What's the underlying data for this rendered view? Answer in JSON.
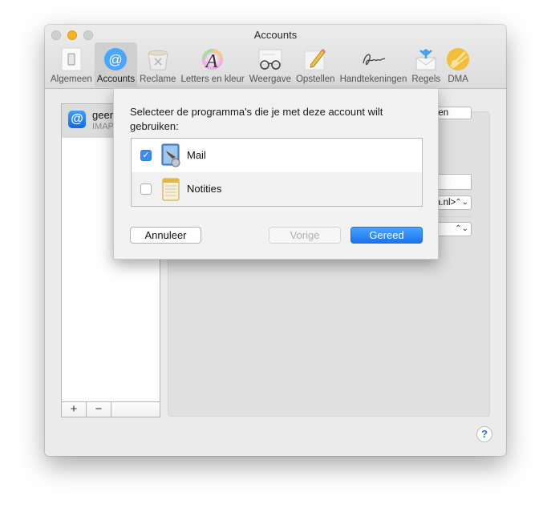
{
  "window": {
    "title": "Accounts",
    "traffic_lights": [
      "close",
      "minimize",
      "zoom"
    ]
  },
  "toolbar": {
    "items": [
      {
        "label": "Algemeen",
        "icon": "switch-icon",
        "active": false
      },
      {
        "label": "Accounts",
        "icon": "at-sign-icon",
        "active": true
      },
      {
        "label": "Reclame",
        "icon": "junk-bin-icon",
        "active": false
      },
      {
        "label": "Letters en kleur",
        "icon": "font-color-icon",
        "active": false
      },
      {
        "label": "Weergave",
        "icon": "glasses-icon",
        "active": false
      },
      {
        "label": "Opstellen",
        "icon": "pencil-icon",
        "active": false
      },
      {
        "label": "Handtekeningen",
        "icon": "signature-icon",
        "active": false
      },
      {
        "label": "Regels",
        "icon": "rules-envelope-icon",
        "active": false
      },
      {
        "label": "DMA",
        "icon": "dma-sun-icon",
        "active": false
      }
    ]
  },
  "accounts_list": {
    "items": [
      {
        "name": "geen",
        "type": "IMAP",
        "icon": "at-sign-icon"
      }
    ],
    "add_label": "+",
    "remove_label": "−"
  },
  "background_detail": {
    "button_label": "ingen",
    "popup_1_value": "a.nl>",
    "popup_2_value": "",
    "updown_glyph": "⌃⌄"
  },
  "sheet": {
    "message": "Selecteer de programma's die je met deze account wilt gebruiken:",
    "apps": [
      {
        "label": "Mail",
        "checked": true,
        "icon": "mail-app-icon"
      },
      {
        "label": "Notities",
        "checked": false,
        "icon": "notes-app-icon"
      }
    ],
    "cancel_label": "Annuleer",
    "previous_label": "Vorige",
    "done_label": "Gereed"
  },
  "help": {
    "label": "?"
  },
  "colors": {
    "accent": "#1a75f0",
    "minimize": "#f5b421"
  }
}
